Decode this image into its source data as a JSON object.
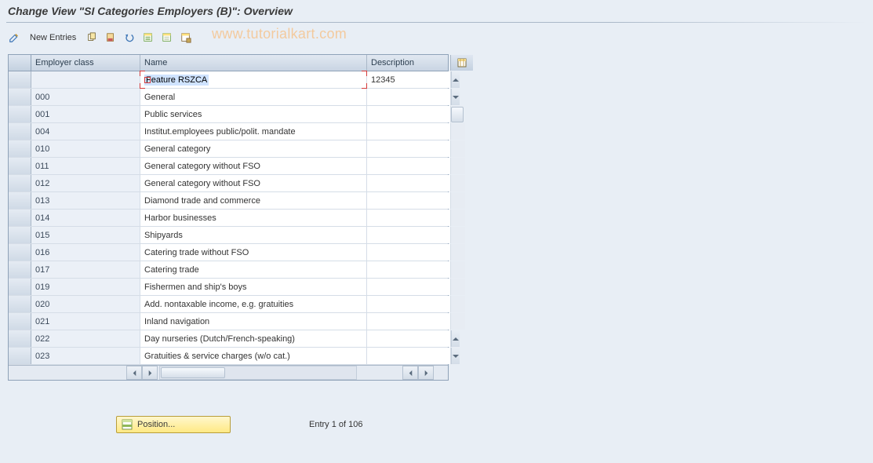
{
  "title": "Change View \"SI Categories Employers (B)\": Overview",
  "watermark": "www.tutorialkart.com",
  "toolbar": {
    "new_entries_label": "New Entries"
  },
  "columns": {
    "employer_class": "Employer class",
    "name": "Name",
    "description": "Description"
  },
  "rows": [
    {
      "class": "",
      "name": "Feature RSZCA",
      "desc": "12345"
    },
    {
      "class": "000",
      "name": "General",
      "desc": ""
    },
    {
      "class": "001",
      "name": "Public services",
      "desc": ""
    },
    {
      "class": "004",
      "name": "Institut.employees public/polit. mandate",
      "desc": ""
    },
    {
      "class": "010",
      "name": "General category",
      "desc": ""
    },
    {
      "class": "011",
      "name": "General category without FSO",
      "desc": ""
    },
    {
      "class": "012",
      "name": "General category without FSO",
      "desc": ""
    },
    {
      "class": "013",
      "name": "Diamond trade and commerce",
      "desc": ""
    },
    {
      "class": "014",
      "name": "Harbor businesses",
      "desc": ""
    },
    {
      "class": "015",
      "name": "Shipyards",
      "desc": ""
    },
    {
      "class": "016",
      "name": "Catering trade without FSO",
      "desc": ""
    },
    {
      "class": "017",
      "name": "Catering trade",
      "desc": ""
    },
    {
      "class": "019",
      "name": "Fishermen and ship's boys",
      "desc": ""
    },
    {
      "class": "020",
      "name": "Add. nontaxable income, e.g. gratuities",
      "desc": ""
    },
    {
      "class": "021",
      "name": "Inland navigation",
      "desc": ""
    },
    {
      "class": "022",
      "name": "Day nurseries (Dutch/French-speaking)",
      "desc": ""
    },
    {
      "class": "023",
      "name": "Gratuities & service charges (w/o cat.)",
      "desc": ""
    }
  ],
  "footer": {
    "position_label": "Position...",
    "entry_label": "Entry 1 of 106"
  }
}
